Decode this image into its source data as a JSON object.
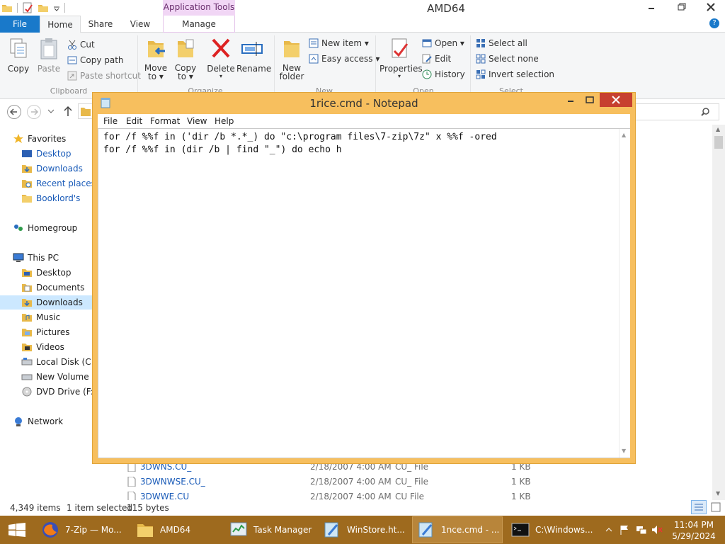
{
  "explorer": {
    "title": "AMD64",
    "contextual_tab_header": "Application Tools",
    "tabs": {
      "file": "File",
      "home": "Home",
      "share": "Share",
      "view": "View",
      "manage": "Manage"
    },
    "ribbon": {
      "clipboard": {
        "copy": "Copy",
        "paste": "Paste",
        "cut": "Cut",
        "copy_path": "Copy path",
        "paste_shortcut": "Paste shortcut",
        "label": "Clipboard"
      },
      "organize": {
        "move_to": "Move\nto ▾",
        "copy_to": "Copy\nto ▾",
        "delete": "Delete",
        "rename": "Rename",
        "label": "Organize"
      },
      "new": {
        "new_folder_line1": "New",
        "new_folder_line2": "folder",
        "new_item": "New item ▾",
        "easy_access": "Easy access ▾",
        "label": "New"
      },
      "open": {
        "properties": "Properties",
        "open": "Open ▾",
        "edit": "Edit",
        "history": "History",
        "label": "Open"
      },
      "select": {
        "select_all": "Select all",
        "select_none": "Select none",
        "invert_selection": "Invert selection",
        "label": "Select"
      }
    },
    "nav": {
      "favorites": "Favorites",
      "desktop": "Desktop",
      "downloads": "Downloads",
      "recent_places": "Recent places",
      "booklords": "Booklord's",
      "homegroup": "Homegroup",
      "this_pc": "This PC",
      "pc_desktop": "Desktop",
      "documents": "Documents",
      "pc_downloads": "Downloads",
      "music": "Music",
      "pictures": "Pictures",
      "videos": "Videos",
      "local_disk": "Local Disk (C:)",
      "new_volume": "New Volume (D",
      "dvd_drive": "DVD Drive (F:) C",
      "network": "Network"
    },
    "files": [
      {
        "name": "3DWNS.CU_",
        "date": "2/18/2007 4:00 AM",
        "type": "CU_ File",
        "size": "1 KB"
      },
      {
        "name": "3DWNWSE.CU_",
        "date": "2/18/2007 4:00 AM",
        "type": "CU_ File",
        "size": "1 KB"
      },
      {
        "name": "3DWWE.CU",
        "date": "2/18/2007 4:00 AM",
        "type": "CU File",
        "size": "1 KB"
      }
    ],
    "status": {
      "item_count": "4,349 items",
      "selected": "1 item selected",
      "size": "115 bytes"
    }
  },
  "notepad": {
    "title": "1rice.cmd - Notepad",
    "menu": {
      "file": "File",
      "edit": "Edit",
      "format": "Format",
      "view": "View",
      "help": "Help"
    },
    "lines": [
      "for /f %%f in ('dir /b *.*_) do \"c:\\program files\\7-zip\\7z\" x %%f -ored",
      "for /f %%f in (dir /b | find \"_\") do echo h"
    ]
  },
  "taskbar": {
    "items": [
      {
        "label": "7-Zip — Mo..."
      },
      {
        "label": "AMD64"
      },
      {
        "label": "Task Manager"
      },
      {
        "label": "WinStore.ht..."
      },
      {
        "label": "1nce.cmd - ..."
      },
      {
        "label": "C:\\Windows..."
      }
    ],
    "clock_time": "11:04 PM",
    "clock_date": "5/29/2024"
  },
  "colors": {
    "file_tab": "#1979ca",
    "app_tools": "#f1d6f5",
    "notepad_frame": "#f7bf5e",
    "taskbar": "#9e6a1e",
    "close_button": "#c7402f",
    "link_blue": "#1a5bb8"
  },
  "icons": {
    "folder": "folder-icon",
    "cut": "scissors-icon",
    "delete": "red-x-icon",
    "notepad": "notepad-icon",
    "firefox": "firefox-icon",
    "windows": "windows-logo-icon"
  }
}
